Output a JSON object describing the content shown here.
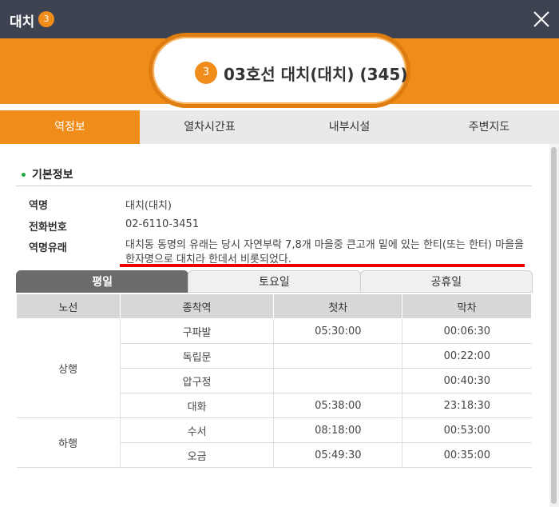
{
  "window": {
    "title": "대치",
    "line_number": "3",
    "close_icon": "close-icon"
  },
  "station_header": {
    "line_number": "3",
    "name": "03호선 대치(대치) (345)",
    "accent_color": "#f08c1a"
  },
  "tabs": [
    {
      "label": "역정보",
      "active": true
    },
    {
      "label": "열차시간표",
      "active": false
    },
    {
      "label": "내부시설",
      "active": false
    },
    {
      "label": "주변지도",
      "active": false
    }
  ],
  "basic_info": {
    "section_title": "기본정보",
    "name_label": "역명",
    "name_value": "대치(대치)",
    "phone_label": "전화번호",
    "phone_value": "02-6110-3451",
    "origin_label": "역명유래",
    "origin_value": "대치동 동명의 유래는 당시 자연부락 7,8개 마을중 큰고개 밑에 있는 한티(또는 한터) 마을을 한자명으로 대치라 한데서 비롯되었다."
  },
  "day_tabs": [
    {
      "label": "평일",
      "active": true
    },
    {
      "label": "토요일",
      "active": false
    },
    {
      "label": "공휴일",
      "active": false
    }
  ],
  "timetable": {
    "headers": [
      "노선",
      "종착역",
      "첫차",
      "막차"
    ],
    "groups": [
      {
        "direction": "상행",
        "rows": [
          {
            "terminal": "구파발",
            "first": "05:30:00",
            "last": "00:06:30"
          },
          {
            "terminal": "독립문",
            "first": "",
            "last": "00:22:00"
          },
          {
            "terminal": "압구정",
            "first": "",
            "last": "00:40:30"
          },
          {
            "terminal": "대화",
            "first": "05:38:00",
            "last": "23:18:30"
          }
        ]
      },
      {
        "direction": "하행",
        "rows": [
          {
            "terminal": "수서",
            "first": "08:18:00",
            "last": "00:53:00"
          },
          {
            "terminal": "오금",
            "first": "05:49:30",
            "last": "00:35:00"
          }
        ]
      }
    ]
  }
}
